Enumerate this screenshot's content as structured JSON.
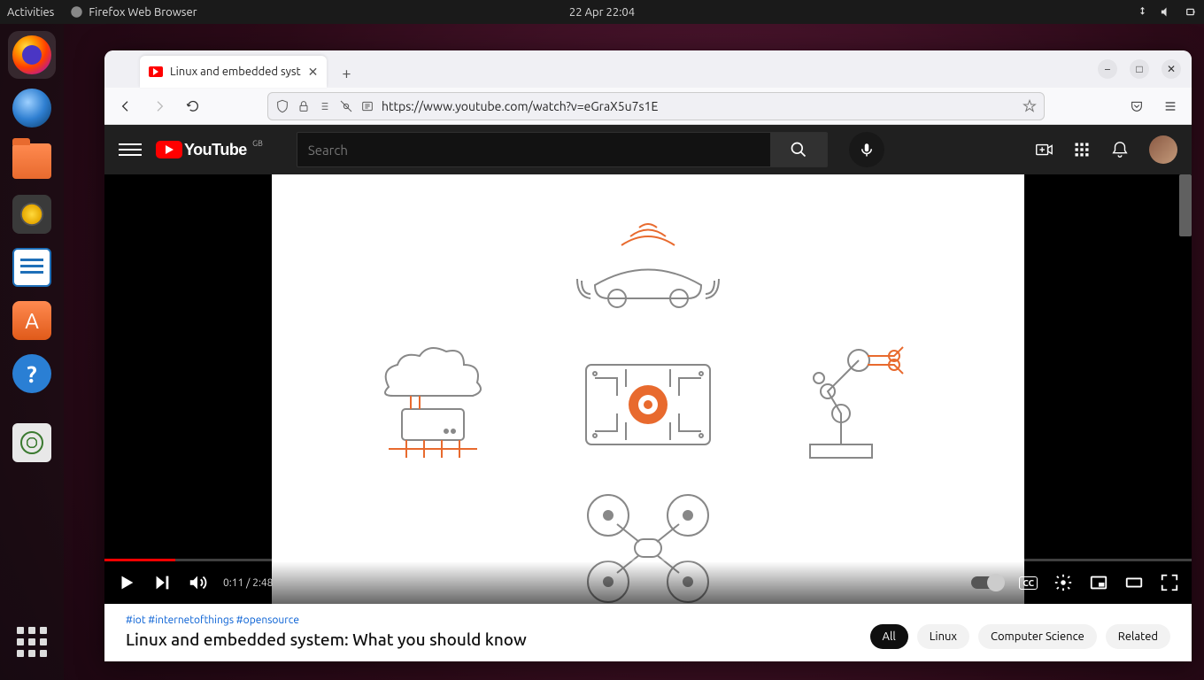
{
  "topbar": {
    "activities": "Activities",
    "app_name": "Firefox Web Browser",
    "clock": "22 Apr  22:04"
  },
  "browser": {
    "tab_title": "Linux and embedded syst",
    "url": "https://www.youtube.com/watch?v=eGraX5u7s1E"
  },
  "youtube": {
    "logo_text": "YouTube",
    "country": "GB",
    "search_placeholder": "Search",
    "hashtags": "#iot #internetofthings #opensource",
    "title": "Linux and embedded system: What you should know",
    "time_current": "0:11",
    "time_total": "2:48",
    "cc_label": "CC",
    "chips": [
      "All",
      "Linux",
      "Computer Science",
      "Related"
    ]
  }
}
